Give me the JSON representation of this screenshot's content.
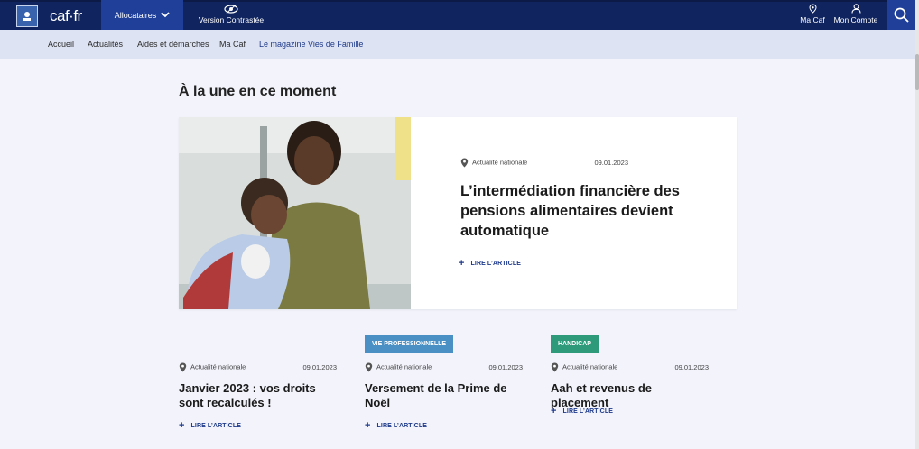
{
  "header": {
    "logo_text": "caf·fr",
    "allocataires_label": "Allocataires",
    "contrast_label": "Version Contrastée",
    "macaf_label": "Ma Caf",
    "compte_label": "Mon Compte"
  },
  "nav": {
    "items": [
      "Accueil",
      "Actualités",
      "Aides et démarches",
      "Ma Caf",
      "Le magazine Vies de Famille"
    ]
  },
  "main": {
    "section_title": "À la une en ce moment",
    "featured": {
      "category": "Actualité nationale",
      "date": "09.01.2023",
      "title": "L’intermédiation financière des pensions alimentaires devient automatique",
      "read_more": "LIRE L’ARTICLE"
    },
    "cards": [
      {
        "badge": "",
        "category": "Actualité nationale",
        "date": "09.01.2023",
        "title": "Janvier 2023 : vos droits sont recalculés !",
        "read_more": "LIRE L’ARTICLE"
      },
      {
        "badge": "VIE PROFESSIONNELLE",
        "badge_color": "#4a90c4",
        "category": "Actualité nationale",
        "date": "09.01.2023",
        "title": "Versement de la Prime de Noël",
        "read_more": "LIRE L’ARTICLE"
      },
      {
        "badge": "HANDICAP",
        "badge_color": "#2e9a7a",
        "category": "Actualité nationale",
        "date": "09.01.2023",
        "title": "Aah et revenus de placement",
        "read_more": "LIRE L’ARTICLE"
      }
    ]
  },
  "colors": {
    "topbar": "#10245f",
    "accent": "#1f3f98",
    "nav_bg": "#dde3f2",
    "page_bg": "#f2f3fb",
    "link": "#1e3a8a"
  }
}
